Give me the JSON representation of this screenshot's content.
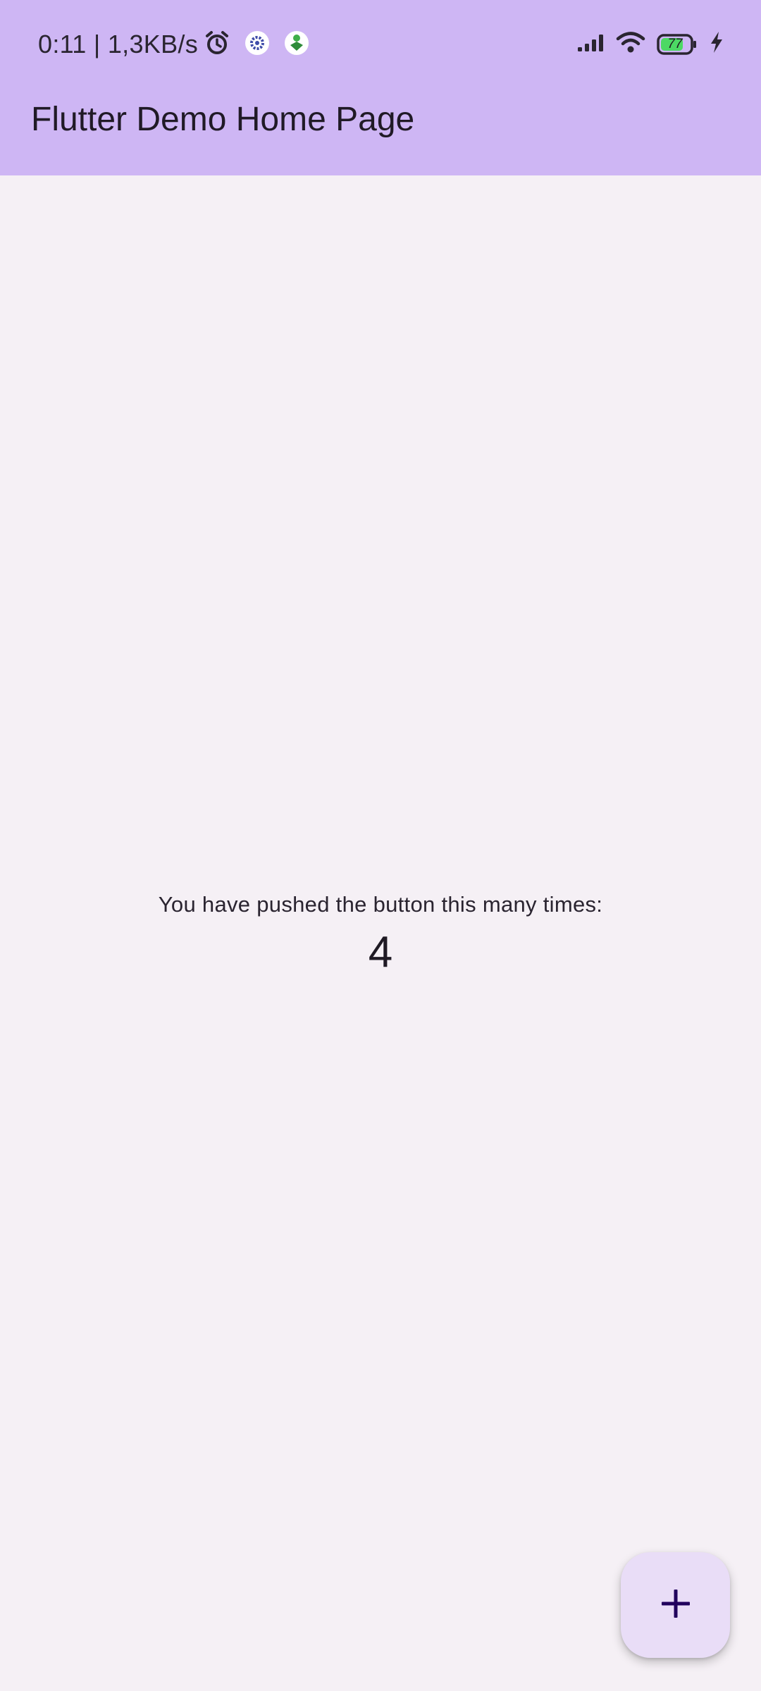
{
  "status_bar": {
    "time_speed": "0:11 | 1,3KB/s",
    "battery_level": "77",
    "icons": [
      "alarm-icon",
      "settings-gear-icon",
      "app-green-icon",
      "signal-icon",
      "wifi-icon",
      "battery-icon",
      "charging-bolt-icon"
    ]
  },
  "app_bar": {
    "title": "Flutter Demo Home Page"
  },
  "main": {
    "caption": "You have pushed the button this many times:",
    "counter": "4"
  },
  "fab": {
    "icon": "plus-icon"
  },
  "colors": {
    "app_bar": "#CEB6F4",
    "background": "#F5F0F5",
    "fab": "#E9DDF7",
    "fab_icon": "#21005D",
    "text": "#1F1A24"
  }
}
